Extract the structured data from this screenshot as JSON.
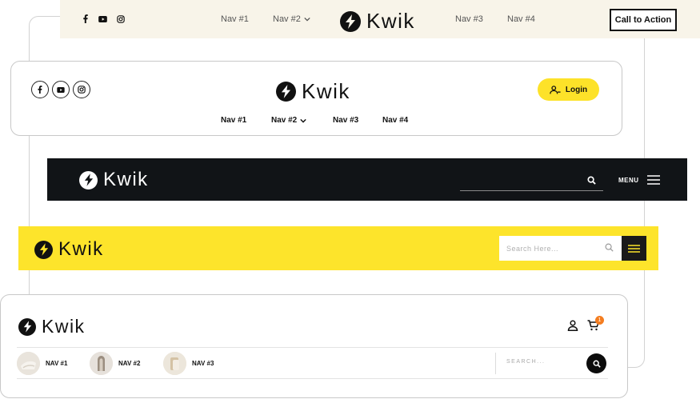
{
  "brand": {
    "name": "Kwik",
    "yellow": "#fde229",
    "dark": "#111417",
    "cream": "#f8f4e9",
    "badge_color": "#f47d20"
  },
  "header_1": {
    "social": [
      "facebook-icon",
      "youtube-icon",
      "instagram-icon"
    ],
    "nav": [
      {
        "label": "Nav #1"
      },
      {
        "label": "Nav #2",
        "dropdown": true
      },
      {
        "label": "Nav #3"
      },
      {
        "label": "Nav #4"
      }
    ],
    "cta_label": "Call to Action"
  },
  "header_2": {
    "social": [
      "facebook-icon",
      "youtube-icon",
      "instagram-icon"
    ],
    "login_label": "Login",
    "nav": [
      {
        "label": "Nav #1"
      },
      {
        "label": "Nav #2",
        "dropdown": true
      },
      {
        "label": "Nav #3"
      },
      {
        "label": "Nav #4"
      }
    ]
  },
  "header_3": {
    "menu_label": "MENU"
  },
  "header_4": {
    "search_placeholder": "Search Here..."
  },
  "header_5": {
    "cart_count": "1",
    "categories": [
      {
        "label": "NAV #1"
      },
      {
        "label": "NAV #2"
      },
      {
        "label": "NAV #3"
      }
    ],
    "search_placeholder": "SEARCH..."
  }
}
